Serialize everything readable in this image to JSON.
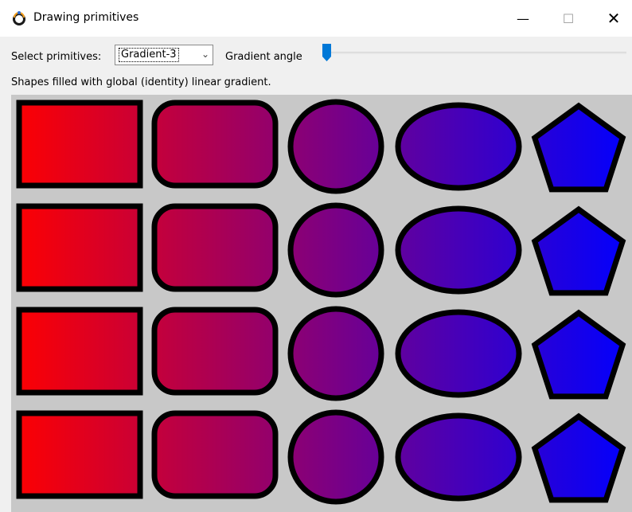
{
  "window": {
    "title": "Drawing primitives",
    "controls": {
      "minimize": "—",
      "maximize": "☐",
      "close": "✕"
    }
  },
  "toolbar": {
    "select_label": "Select primitives:",
    "select_value": "Gradient-3",
    "angle_label": "Gradient angle",
    "angle_value": 0
  },
  "description": "Shapes filled with global (identity) linear gradient.",
  "colors": {
    "gradient_start": "#ff0000",
    "gradient_end": "#0000ff",
    "stroke": "#000000",
    "canvas_bg": "#c8c8c8",
    "accent": "#0078d7"
  },
  "shapes": {
    "rows": 4,
    "columns": [
      "rectangle",
      "rounded-rectangle",
      "circle",
      "ellipse",
      "pentagon"
    ]
  }
}
